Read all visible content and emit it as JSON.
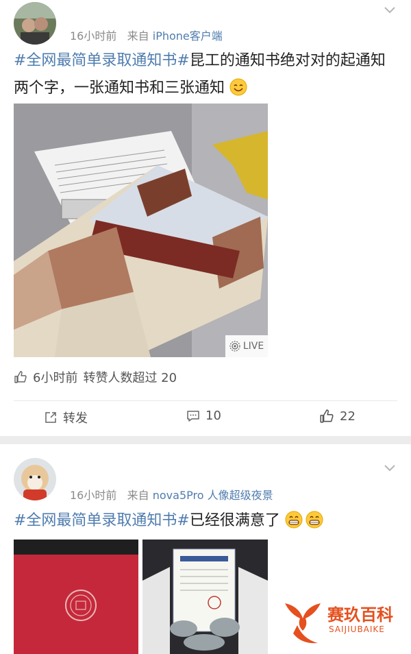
{
  "post1": {
    "time": "16小时前",
    "source_prefix": "来自",
    "source": "iPhone客户端",
    "hashtag": "#全网最简单录取通知书#",
    "text": "昆工的通知书绝对对的起通知两个字，一张通知书和三张通知",
    "emoji": "smile-emoji",
    "live_label": "LIVE",
    "likes_time": "6小时前",
    "likes_text": "转赞人数超过 20",
    "actions": {
      "repost_label": "转发",
      "comment_count": "10",
      "like_count": "22"
    }
  },
  "post2": {
    "time": "16小时前",
    "source_prefix": "来自",
    "source": "nova5Pro 人像超级夜景",
    "hashtag": "#全网最简单录取通知书#",
    "text": "已经很满意了",
    "emojis": [
      "grin-emoji",
      "grin-emoji"
    ]
  },
  "watermark": {
    "name_cn": "赛玖百科",
    "name_en": "SAIJIUBAIKE"
  },
  "icons": [
    "chevron-down-icon",
    "thumb-up-icon",
    "repost-icon",
    "comment-icon",
    "like-icon",
    "live-icon"
  ],
  "colors": {
    "link": "#4f7cae",
    "brand": "#e5501f",
    "background": "#ececec"
  }
}
